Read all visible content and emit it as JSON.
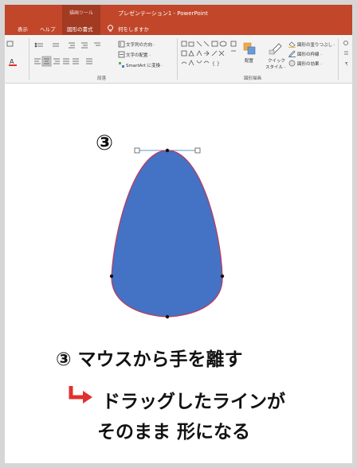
{
  "window": {
    "context_tab_group": "描画ツール",
    "title": "プレゼンテーション1  -  PowerPoint"
  },
  "tabs": [
    {
      "label": "表示"
    },
    {
      "label": "ヘルプ"
    },
    {
      "label": "図形の書式"
    },
    {
      "label": "何をしますか"
    }
  ],
  "ribbon": {
    "text_direction": "文字列の方向 ·",
    "align_text": "文字の配置 ·",
    "smartart": "SmartArt に変換 ·",
    "group_paragraph": "段落",
    "arrange": "配置",
    "quick_styles_1": "クイック",
    "quick_styles_2": "スタイル ·",
    "shape_fill": "図形の塗りつぶし ·",
    "shape_outline": "図形の枠線 ·",
    "shape_effects": "図形の効果 ·",
    "group_drawing": "図形描画"
  },
  "slide": {
    "step_marker": "③",
    "caption_line1": "③ マウスから手を離す",
    "caption_line2": "ドラッグしたラインが",
    "caption_line3": "そのまま 形になる"
  },
  "colors": {
    "title_bar": "#c1462a",
    "shape_fill": "#4472c4",
    "shape_outline": "#c0395a",
    "arrow": "#e03030"
  }
}
